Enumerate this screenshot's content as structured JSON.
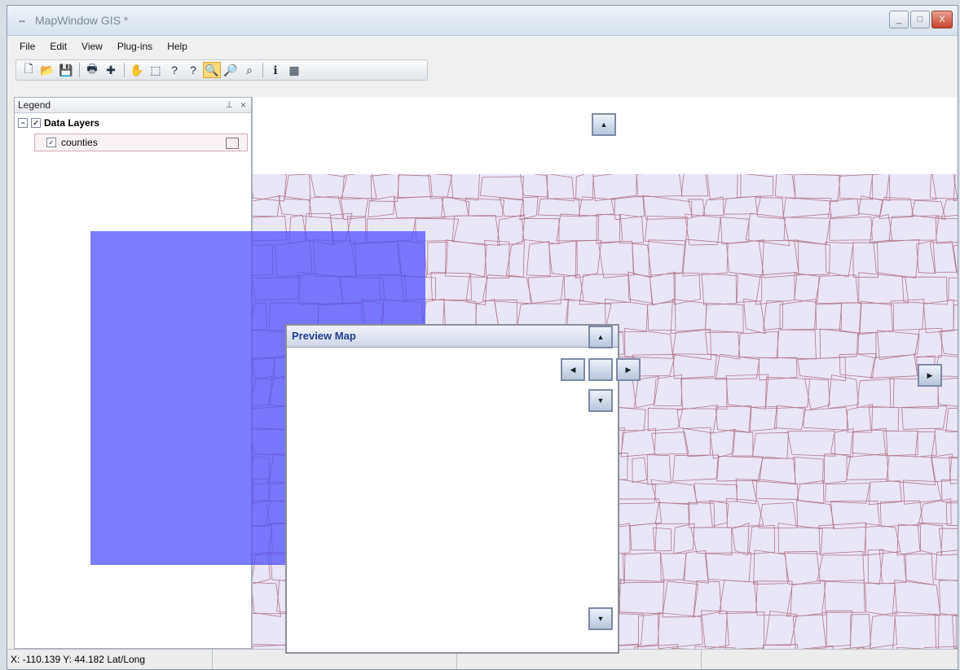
{
  "window": {
    "title": "MapWindow GIS *",
    "buttons": {
      "minimize": "_",
      "maximize": "□",
      "close": "X"
    }
  },
  "menu": [
    "File",
    "Edit",
    "View",
    "Plug-ins",
    "Help"
  ],
  "toolbar": {
    "icons": [
      "new-file-icon",
      "open-folder-icon",
      "save-icon",
      "print-icon",
      "add-layer-icon",
      "pan-icon",
      "select-icon",
      "help-icon",
      "whats-this-icon",
      "zoom-in-icon",
      "zoom-out-icon",
      "zoom-extent-icon",
      "identify-icon",
      "attribute-table-icon"
    ],
    "active": "zoom-in-icon"
  },
  "legend": {
    "title": "Legend",
    "pin": "⊥",
    "close": "×",
    "group": "Data Layers",
    "group_expander": "−",
    "layer": "counties",
    "checkbox": "✓"
  },
  "preview": {
    "title": "Preview Map"
  },
  "nav_glyphs": {
    "up": "▲",
    "down": "▼",
    "left": "◀",
    "right": "▶"
  },
  "colors": {
    "selection": "#5050ff",
    "county_border": "#b07a8a",
    "county_fill": "#e9e6f6"
  },
  "status": {
    "coords": "X: -110.139   Y: 44.182 Lat/Long"
  }
}
